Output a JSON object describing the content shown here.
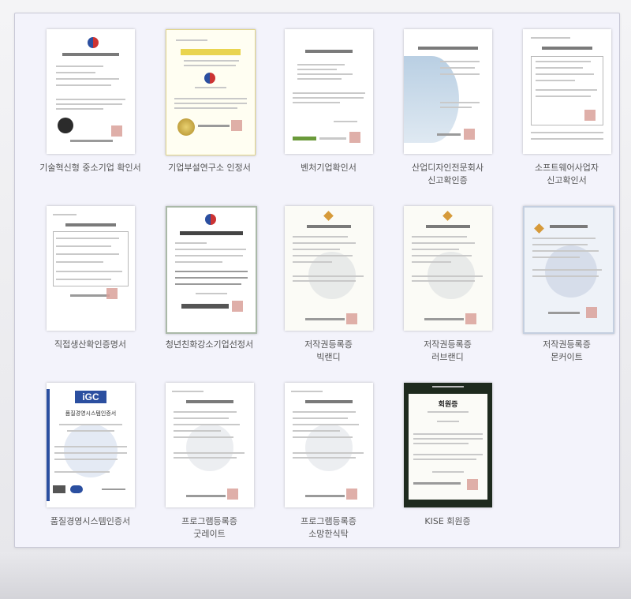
{
  "gallery": {
    "items": [
      {
        "line1": "기술혁신형 중소기업 확인서",
        "line2": "",
        "icon": "certificate-document-icon"
      },
      {
        "line1": "기업부설연구소 인정서",
        "line2": "",
        "icon": "certificate-document-icon"
      },
      {
        "line1": "벤처기업확인서",
        "line2": "",
        "icon": "certificate-document-icon"
      },
      {
        "line1": "산업디자인전문회사",
        "line2": "신고확인증",
        "icon": "certificate-document-icon"
      },
      {
        "line1": "소프트웨어사업자",
        "line2": "신고확인서",
        "icon": "certificate-document-icon"
      },
      {
        "line1": "직접생산확인증명서",
        "line2": "",
        "icon": "certificate-document-icon"
      },
      {
        "line1": "청년친화강소기업선정서",
        "line2": "",
        "icon": "certificate-document-icon"
      },
      {
        "line1": "저작권등록증",
        "line2": "빅랜디",
        "icon": "certificate-document-icon"
      },
      {
        "line1": "저작권등록증",
        "line2": "러브랜디",
        "icon": "certificate-document-icon"
      },
      {
        "line1": "저작권등록증",
        "line2": "몬커이트",
        "icon": "certificate-document-icon"
      },
      {
        "line1": "품질경영시스템인증서",
        "line2": "",
        "icon": "certificate-document-icon"
      },
      {
        "line1": "프로그램등록증",
        "line2": "굿레이트",
        "icon": "certificate-document-icon"
      },
      {
        "line1": "프로그램등록증",
        "line2": "소망한식탁",
        "icon": "certificate-document-icon"
      },
      {
        "line1": "KISE 회원증",
        "line2": "",
        "icon": "certificate-document-icon"
      }
    ]
  },
  "thumbs": {
    "igc_logo": "iGC",
    "igc_title": "품질경영시스템인증서",
    "kise_title": "회원증"
  },
  "colors": {
    "panel_bg": "#f3f3fb",
    "caption": "#555555",
    "stamp": "#d9a19a",
    "igc_blue": "#2b4fa0"
  }
}
